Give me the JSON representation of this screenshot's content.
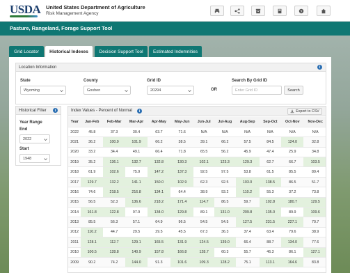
{
  "header": {
    "logo": "USDA",
    "agency_line1": "United States Department of Agriculture",
    "agency_line2": "Risk Management Agency",
    "buttons": [
      {
        "icon": "print-icon"
      },
      {
        "icon": "share-icon"
      },
      {
        "icon": "archive-icon"
      },
      {
        "icon": "calculator-icon"
      },
      {
        "icon": "help-icon"
      },
      {
        "icon": "home-icon"
      }
    ]
  },
  "app_title": "Pasture, Rangeland, Forage Support Tool",
  "tabs": [
    {
      "label": "Grid Locator",
      "active": false
    },
    {
      "label": "Historical Indexes",
      "active": true
    },
    {
      "label": "Decision Support Tool",
      "active": false
    },
    {
      "label": "Estimated Indemnities",
      "active": false
    }
  ],
  "location": {
    "title": "Location Information",
    "state_label": "State",
    "state_value": "Wyoming",
    "county_label": "County",
    "county_value": "Goshen",
    "grid_label": "Grid ID",
    "grid_value": "20294",
    "or_text": "OR",
    "search_label": "Search By Grid ID",
    "search_placeholder": "Enter Grid ID",
    "search_button": "Search"
  },
  "filter": {
    "title": "Historical Filter",
    "year_range_label": "Year Range",
    "end_label": "End",
    "end_value": "2022",
    "start_label": "Start",
    "start_value": "1948"
  },
  "index": {
    "title": "Index Values - Percent of Normal",
    "export_label": "Export to CSV",
    "columns": [
      "Year",
      "Jan-Feb",
      "Feb-Mar",
      "Mar-Apr",
      "Apr-May",
      "May-Jun",
      "Jun-Jul",
      "Jul-Aug",
      "Aug-Sep",
      "Sep-Oct",
      "Oct-Nov",
      "Nov-Dec"
    ],
    "rows": [
      [
        "2022",
        "45.8",
        "37.3",
        "30.4",
        "63.7",
        "71.6",
        "N/A",
        "N/A",
        "N/A",
        "N/A",
        "N/A",
        "N/A"
      ],
      [
        "2021",
        "36.2",
        "100.9",
        "101.9",
        "66.2",
        "38.5",
        "39.1",
        "66.2",
        "57.5",
        "84.5",
        "124.0",
        "32.8"
      ],
      [
        "2020",
        "33.2",
        "34.4",
        "49.1",
        "66.4",
        "71.8",
        "65.5",
        "56.2",
        "45.9",
        "47.4",
        "25.9",
        "34.8"
      ],
      [
        "2019",
        "35.2",
        "136.1",
        "132.7",
        "132.8",
        "130.3",
        "102.1",
        "123.3",
        "129.3",
        "62.7",
        "66.7",
        "103.5"
      ],
      [
        "2018",
        "61.9",
        "102.6",
        "75.9",
        "147.2",
        "137.3",
        "92.5",
        "97.5",
        "53.8",
        "61.5",
        "85.5",
        "89.4"
      ],
      [
        "2017",
        "129.7",
        "132.2",
        "141.1",
        "150.0",
        "102.9",
        "62.3",
        "92.5",
        "103.0",
        "138.5",
        "86.5",
        "51.7"
      ],
      [
        "2016",
        "74.6",
        "218.5",
        "216.8",
        "134.1",
        "64.4",
        "38.9",
        "93.2",
        "110.2",
        "55.3",
        "37.2",
        "73.8"
      ],
      [
        "2015",
        "56.5",
        "52.3",
        "136.6",
        "218.2",
        "171.4",
        "114.7",
        "86.5",
        "59.7",
        "102.8",
        "180.7",
        "129.5"
      ],
      [
        "2014",
        "161.8",
        "122.8",
        "97.9",
        "134.0",
        "129.8",
        "89.1",
        "131.0",
        "209.8",
        "135.0",
        "89.9",
        "109.6"
      ],
      [
        "2013",
        "85.5",
        "56.3",
        "57.1",
        "64.9",
        "96.5",
        "54.5",
        "54.5",
        "127.5",
        "231.5",
        "227.1",
        "70.7"
      ],
      [
        "2012",
        "110.2",
        "44.7",
        "29.5",
        "29.5",
        "45.5",
        "67.3",
        "36.3",
        "37.4",
        "63.4",
        "79.6",
        "38.9"
      ],
      [
        "2011",
        "128.1",
        "112.7",
        "129.1",
        "165.5",
        "131.9",
        "124.5",
        "139.0",
        "66.4",
        "88.7",
        "134.0",
        "77.6"
      ],
      [
        "2010",
        "100.5",
        "128.8",
        "140.9",
        "157.8",
        "166.8",
        "128.7",
        "60.3",
        "55.7",
        "46.3",
        "86.1",
        "127.1"
      ],
      [
        "2009",
        "90.2",
        "74.2",
        "144.0",
        "91.3",
        "101.6",
        "109.3",
        "128.2",
        "75.1",
        "113.1",
        "164.6",
        "83.8"
      ]
    ]
  }
}
